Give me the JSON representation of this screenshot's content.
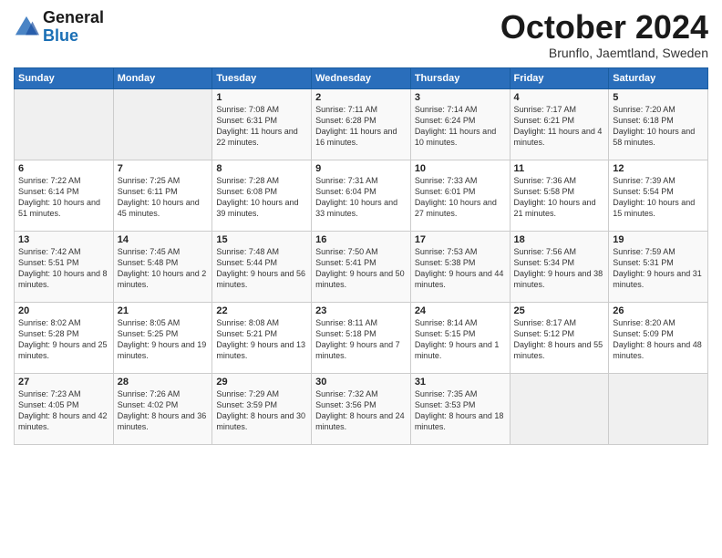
{
  "header": {
    "logo_line1": "General",
    "logo_line2": "Blue",
    "month": "October 2024",
    "location": "Brunflo, Jaemtland, Sweden"
  },
  "weekdays": [
    "Sunday",
    "Monday",
    "Tuesday",
    "Wednesday",
    "Thursday",
    "Friday",
    "Saturday"
  ],
  "weeks": [
    [
      {
        "day": "",
        "detail": ""
      },
      {
        "day": "",
        "detail": ""
      },
      {
        "day": "1",
        "detail": "Sunrise: 7:08 AM\nSunset: 6:31 PM\nDaylight: 11 hours\nand 22 minutes."
      },
      {
        "day": "2",
        "detail": "Sunrise: 7:11 AM\nSunset: 6:28 PM\nDaylight: 11 hours\nand 16 minutes."
      },
      {
        "day": "3",
        "detail": "Sunrise: 7:14 AM\nSunset: 6:24 PM\nDaylight: 11 hours\nand 10 minutes."
      },
      {
        "day": "4",
        "detail": "Sunrise: 7:17 AM\nSunset: 6:21 PM\nDaylight: 11 hours\nand 4 minutes."
      },
      {
        "day": "5",
        "detail": "Sunrise: 7:20 AM\nSunset: 6:18 PM\nDaylight: 10 hours\nand 58 minutes."
      }
    ],
    [
      {
        "day": "6",
        "detail": "Sunrise: 7:22 AM\nSunset: 6:14 PM\nDaylight: 10 hours\nand 51 minutes."
      },
      {
        "day": "7",
        "detail": "Sunrise: 7:25 AM\nSunset: 6:11 PM\nDaylight: 10 hours\nand 45 minutes."
      },
      {
        "day": "8",
        "detail": "Sunrise: 7:28 AM\nSunset: 6:08 PM\nDaylight: 10 hours\nand 39 minutes."
      },
      {
        "day": "9",
        "detail": "Sunrise: 7:31 AM\nSunset: 6:04 PM\nDaylight: 10 hours\nand 33 minutes."
      },
      {
        "day": "10",
        "detail": "Sunrise: 7:33 AM\nSunset: 6:01 PM\nDaylight: 10 hours\nand 27 minutes."
      },
      {
        "day": "11",
        "detail": "Sunrise: 7:36 AM\nSunset: 5:58 PM\nDaylight: 10 hours\nand 21 minutes."
      },
      {
        "day": "12",
        "detail": "Sunrise: 7:39 AM\nSunset: 5:54 PM\nDaylight: 10 hours\nand 15 minutes."
      }
    ],
    [
      {
        "day": "13",
        "detail": "Sunrise: 7:42 AM\nSunset: 5:51 PM\nDaylight: 10 hours\nand 8 minutes."
      },
      {
        "day": "14",
        "detail": "Sunrise: 7:45 AM\nSunset: 5:48 PM\nDaylight: 10 hours\nand 2 minutes."
      },
      {
        "day": "15",
        "detail": "Sunrise: 7:48 AM\nSunset: 5:44 PM\nDaylight: 9 hours\nand 56 minutes."
      },
      {
        "day": "16",
        "detail": "Sunrise: 7:50 AM\nSunset: 5:41 PM\nDaylight: 9 hours\nand 50 minutes."
      },
      {
        "day": "17",
        "detail": "Sunrise: 7:53 AM\nSunset: 5:38 PM\nDaylight: 9 hours\nand 44 minutes."
      },
      {
        "day": "18",
        "detail": "Sunrise: 7:56 AM\nSunset: 5:34 PM\nDaylight: 9 hours\nand 38 minutes."
      },
      {
        "day": "19",
        "detail": "Sunrise: 7:59 AM\nSunset: 5:31 PM\nDaylight: 9 hours\nand 31 minutes."
      }
    ],
    [
      {
        "day": "20",
        "detail": "Sunrise: 8:02 AM\nSunset: 5:28 PM\nDaylight: 9 hours\nand 25 minutes."
      },
      {
        "day": "21",
        "detail": "Sunrise: 8:05 AM\nSunset: 5:25 PM\nDaylight: 9 hours\nand 19 minutes."
      },
      {
        "day": "22",
        "detail": "Sunrise: 8:08 AM\nSunset: 5:21 PM\nDaylight: 9 hours\nand 13 minutes."
      },
      {
        "day": "23",
        "detail": "Sunrise: 8:11 AM\nSunset: 5:18 PM\nDaylight: 9 hours\nand 7 minutes."
      },
      {
        "day": "24",
        "detail": "Sunrise: 8:14 AM\nSunset: 5:15 PM\nDaylight: 9 hours\nand 1 minute."
      },
      {
        "day": "25",
        "detail": "Sunrise: 8:17 AM\nSunset: 5:12 PM\nDaylight: 8 hours\nand 55 minutes."
      },
      {
        "day": "26",
        "detail": "Sunrise: 8:20 AM\nSunset: 5:09 PM\nDaylight: 8 hours\nand 48 minutes."
      }
    ],
    [
      {
        "day": "27",
        "detail": "Sunrise: 7:23 AM\nSunset: 4:05 PM\nDaylight: 8 hours\nand 42 minutes."
      },
      {
        "day": "28",
        "detail": "Sunrise: 7:26 AM\nSunset: 4:02 PM\nDaylight: 8 hours\nand 36 minutes."
      },
      {
        "day": "29",
        "detail": "Sunrise: 7:29 AM\nSunset: 3:59 PM\nDaylight: 8 hours\nand 30 minutes."
      },
      {
        "day": "30",
        "detail": "Sunrise: 7:32 AM\nSunset: 3:56 PM\nDaylight: 8 hours\nand 24 minutes."
      },
      {
        "day": "31",
        "detail": "Sunrise: 7:35 AM\nSunset: 3:53 PM\nDaylight: 8 hours\nand 18 minutes."
      },
      {
        "day": "",
        "detail": ""
      },
      {
        "day": "",
        "detail": ""
      }
    ]
  ]
}
